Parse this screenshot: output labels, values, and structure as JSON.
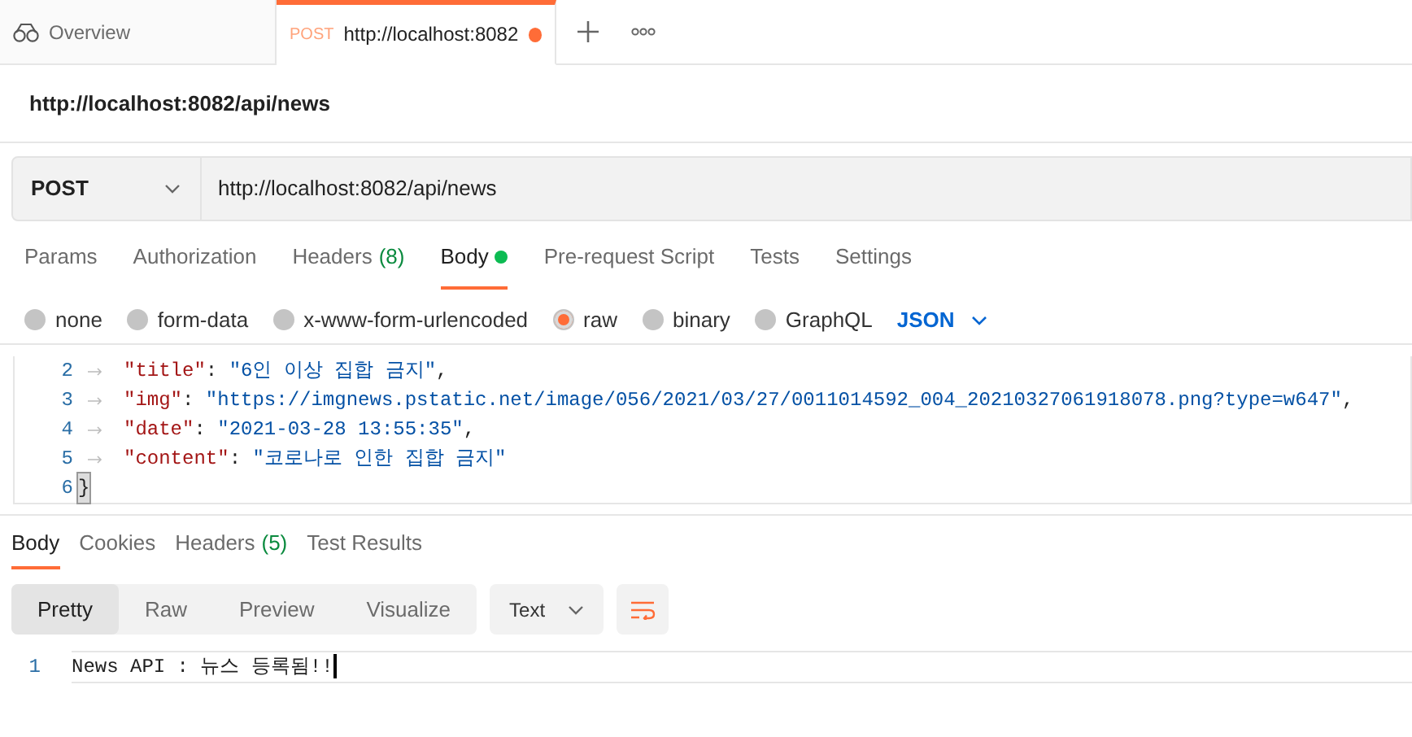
{
  "tabs": [
    {
      "kind": "overview",
      "label": "Overview",
      "selected": false
    },
    {
      "kind": "request",
      "method": "POST",
      "label": "http://localhost:8082",
      "selected": true,
      "unsaved": true
    }
  ],
  "request_title": "http://localhost:8082/api/news",
  "method": "POST",
  "url": "http://localhost:8082/api/news",
  "request_tabs": [
    {
      "label": "Params",
      "selected": false
    },
    {
      "label": "Authorization",
      "selected": false
    },
    {
      "label": "Headers",
      "count": "(8)",
      "selected": false
    },
    {
      "label": "Body",
      "selected": true,
      "has_content": true
    },
    {
      "label": "Pre-request Script",
      "selected": false
    },
    {
      "label": "Tests",
      "selected": false
    },
    {
      "label": "Settings",
      "selected": false
    }
  ],
  "body_types": [
    {
      "label": "none",
      "selected": false
    },
    {
      "label": "form-data",
      "selected": false
    },
    {
      "label": "x-www-form-urlencoded",
      "selected": false
    },
    {
      "label": "raw",
      "selected": true
    },
    {
      "label": "binary",
      "selected": false
    },
    {
      "label": "GraphQL",
      "selected": false
    }
  ],
  "body_format": "JSON",
  "code_lines": [
    {
      "number": "2",
      "kind": "pair",
      "key": "\"title\"",
      "sep": ":",
      "value": "\"6인 이상 집합 금지\"",
      "trail": ","
    },
    {
      "number": "3",
      "kind": "pair",
      "key": "\"img\"",
      "sep": ":",
      "value": "\"https://imgnews.pstatic.net/image/056/2021/03/27/0011014592_004_20210327061918078.png?type=w647\"",
      "trail": ","
    },
    {
      "number": "4",
      "kind": "pair",
      "key": "\"date\"",
      "sep": ":",
      "value": "\"2021-03-28 13:55:35\"",
      "trail": ","
    },
    {
      "number": "5",
      "kind": "pair",
      "key": "\"content\"",
      "sep": ":",
      "value": "\"코로나로 인한 집합 금지\""
    },
    {
      "number": "6",
      "kind": "brace",
      "text": "}"
    }
  ],
  "response_tabs": [
    {
      "label": "Body",
      "selected": true
    },
    {
      "label": "Cookies",
      "selected": false
    },
    {
      "label": "Headers",
      "count": "(5)",
      "selected": false
    },
    {
      "label": "Test Results",
      "selected": false
    }
  ],
  "view_modes": [
    {
      "label": "Pretty",
      "selected": true
    },
    {
      "label": "Raw",
      "selected": false
    },
    {
      "label": "Preview",
      "selected": false
    },
    {
      "label": "Visualize",
      "selected": false
    }
  ],
  "response_format": "Text",
  "response_lines": [
    {
      "number": "1",
      "text": "News API : 뉴스 등록됨!!"
    }
  ]
}
